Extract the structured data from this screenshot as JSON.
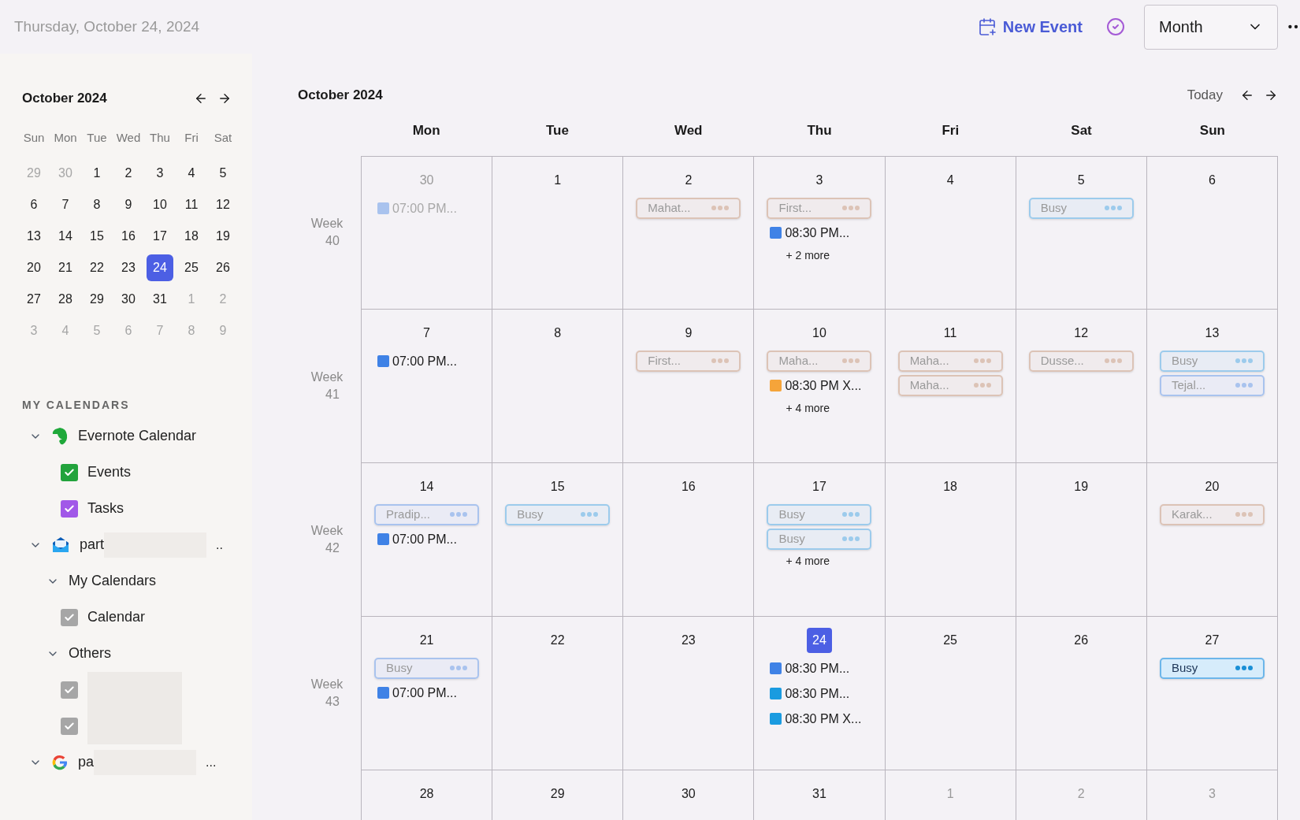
{
  "header": {
    "date": "Thursday, October 24, 2024",
    "new_event": "New Event",
    "view_select": "Month"
  },
  "mini_calendar": {
    "title": "October 2024",
    "weekdays": [
      "Sun",
      "Mon",
      "Tue",
      "Wed",
      "Thu",
      "Fri",
      "Sat"
    ],
    "weeks": [
      [
        {
          "d": "29",
          "outside": true,
          "selected": false
        },
        {
          "d": "30",
          "outside": true,
          "selected": false
        },
        {
          "d": "1",
          "outside": false,
          "selected": false
        },
        {
          "d": "2",
          "outside": false,
          "selected": false
        },
        {
          "d": "3",
          "outside": false,
          "selected": false
        },
        {
          "d": "4",
          "outside": false,
          "selected": false
        },
        {
          "d": "5",
          "outside": false,
          "selected": false
        }
      ],
      [
        {
          "d": "6",
          "outside": false,
          "selected": false
        },
        {
          "d": "7",
          "outside": false,
          "selected": false
        },
        {
          "d": "8",
          "outside": false,
          "selected": false
        },
        {
          "d": "9",
          "outside": false,
          "selected": false
        },
        {
          "d": "10",
          "outside": false,
          "selected": false
        },
        {
          "d": "11",
          "outside": false,
          "selected": false
        },
        {
          "d": "12",
          "outside": false,
          "selected": false
        }
      ],
      [
        {
          "d": "13",
          "outside": false,
          "selected": false
        },
        {
          "d": "14",
          "outside": false,
          "selected": false
        },
        {
          "d": "15",
          "outside": false,
          "selected": false
        },
        {
          "d": "16",
          "outside": false,
          "selected": false
        },
        {
          "d": "17",
          "outside": false,
          "selected": false
        },
        {
          "d": "18",
          "outside": false,
          "selected": false
        },
        {
          "d": "19",
          "outside": false,
          "selected": false
        }
      ],
      [
        {
          "d": "20",
          "outside": false,
          "selected": false
        },
        {
          "d": "21",
          "outside": false,
          "selected": false
        },
        {
          "d": "22",
          "outside": false,
          "selected": false
        },
        {
          "d": "23",
          "outside": false,
          "selected": false
        },
        {
          "d": "24",
          "outside": false,
          "selected": true
        },
        {
          "d": "25",
          "outside": false,
          "selected": false
        },
        {
          "d": "26",
          "outside": false,
          "selected": false
        }
      ],
      [
        {
          "d": "27",
          "outside": false,
          "selected": false
        },
        {
          "d": "28",
          "outside": false,
          "selected": false
        },
        {
          "d": "29",
          "outside": false,
          "selected": false
        },
        {
          "d": "30",
          "outside": false,
          "selected": false
        },
        {
          "d": "31",
          "outside": false,
          "selected": false
        },
        {
          "d": "1",
          "outside": true,
          "selected": false
        },
        {
          "d": "2",
          "outside": true,
          "selected": false
        }
      ],
      [
        {
          "d": "3",
          "outside": true,
          "selected": false
        },
        {
          "d": "4",
          "outside": true,
          "selected": false
        },
        {
          "d": "5",
          "outside": true,
          "selected": false
        },
        {
          "d": "6",
          "outside": true,
          "selected": false
        },
        {
          "d": "7",
          "outside": true,
          "selected": false
        },
        {
          "d": "8",
          "outside": true,
          "selected": false
        },
        {
          "d": "9",
          "outside": true,
          "selected": false
        }
      ]
    ]
  },
  "calendars": {
    "heading": "MY CALENDARS",
    "items": [
      {
        "kind": "account",
        "label": "Evernote Calendar",
        "expanded": true,
        "children": [
          {
            "kind": "check",
            "label": "Events",
            "checked": true,
            "color": "#22a33c"
          },
          {
            "kind": "check",
            "label": "Tasks",
            "checked": true,
            "color": "#a158e8"
          }
        ]
      },
      {
        "kind": "account",
        "label": "part",
        "redacted": true,
        "trail": "..",
        "expanded": true,
        "children": [
          {
            "kind": "group",
            "label": "My Calendars",
            "expanded": true,
            "children": [
              {
                "kind": "check",
                "label": "Calendar",
                "checked": true,
                "color": "#a6a6a6"
              }
            ]
          },
          {
            "kind": "group",
            "label": "Others",
            "expanded": true,
            "children": [
              {
                "kind": "check",
                "redacted": true,
                "checked": true,
                "color": "#a6a6a6"
              },
              {
                "kind": "check",
                "redacted": true,
                "checked": true,
                "color": "#a6a6a6"
              }
            ]
          }
        ]
      },
      {
        "kind": "account",
        "label": "pa",
        "redacted": true,
        "trail": "...",
        "expanded": true
      }
    ]
  },
  "month": {
    "title": "October 2024",
    "today": "Today",
    "weekdays": [
      "Mon",
      "Tue",
      "Wed",
      "Thu",
      "Fri",
      "Sat",
      "Sun"
    ],
    "weeks": [
      {
        "label": "Week",
        "number": "40",
        "days": [
          {
            "date": "30",
            "outside": true,
            "today": false,
            "events": [
              {
                "kind": "timed",
                "title": "07:00 PM...",
                "color": "#a9c3ee"
              }
            ]
          },
          {
            "date": "1",
            "outside": false,
            "today": false
          },
          {
            "date": "2",
            "outside": false,
            "today": false,
            "events": [
              {
                "kind": "pill",
                "title": "Mahat...",
                "color": "#dcc3b6",
                "selected": false
              }
            ]
          },
          {
            "date": "3",
            "outside": false,
            "today": false,
            "events": [
              {
                "kind": "pill",
                "title": "First...",
                "color": "#dcc3b6",
                "selected": false
              },
              {
                "kind": "timed",
                "title": "08:30 PM...",
                "color": "#3f82e6"
              },
              {
                "kind": "more",
                "title": "+ 2 more"
              }
            ]
          },
          {
            "date": "4",
            "outside": false,
            "today": false
          },
          {
            "date": "5",
            "outside": false,
            "today": false,
            "events": [
              {
                "kind": "pill",
                "title": "Busy",
                "color": "#9ccbec",
                "selected": false
              }
            ]
          },
          {
            "date": "6",
            "outside": false,
            "today": false
          }
        ]
      },
      {
        "label": "Week",
        "number": "41",
        "days": [
          {
            "date": "7",
            "outside": false,
            "today": false,
            "events": [
              {
                "kind": "timed",
                "title": "07:00 PM...",
                "color": "#3f82e6"
              }
            ]
          },
          {
            "date": "8",
            "outside": false,
            "today": false
          },
          {
            "date": "9",
            "outside": false,
            "today": false,
            "events": [
              {
                "kind": "pill",
                "title": "First...",
                "color": "#dcc3b6",
                "selected": false
              }
            ]
          },
          {
            "date": "10",
            "outside": false,
            "today": false,
            "events": [
              {
                "kind": "pill",
                "title": "Maha...",
                "color": "#dcc3b6",
                "selected": false
              },
              {
                "kind": "timed",
                "title": "08:30 PM X...",
                "color": "#f5a43a"
              },
              {
                "kind": "more",
                "title": "+ 4 more"
              }
            ]
          },
          {
            "date": "11",
            "outside": false,
            "today": false,
            "events": [
              {
                "kind": "pill",
                "title": "Maha...",
                "color": "#dcc3b6",
                "selected": false
              },
              {
                "kind": "pill",
                "title": "Maha...",
                "color": "#dcc3b6",
                "selected": false
              }
            ]
          },
          {
            "date": "12",
            "outside": false,
            "today": false,
            "events": [
              {
                "kind": "pill",
                "title": "Dusse...",
                "color": "#dcc3b6",
                "selected": false
              }
            ]
          },
          {
            "date": "13",
            "outside": false,
            "today": false,
            "events": [
              {
                "kind": "pill",
                "title": "Busy",
                "color": "#9ccbec",
                "selected": false
              },
              {
                "kind": "pill",
                "title": "Tejal...",
                "color": "#a9c3ee",
                "selected": false
              }
            ]
          }
        ]
      },
      {
        "label": "Week",
        "number": "42",
        "days": [
          {
            "date": "14",
            "outside": false,
            "today": false,
            "events": [
              {
                "kind": "pill",
                "title": "Pradip...",
                "color": "#a9c3ee",
                "selected": false
              },
              {
                "kind": "timed",
                "title": "07:00 PM...",
                "color": "#3f82e6"
              }
            ]
          },
          {
            "date": "15",
            "outside": false,
            "today": false,
            "events": [
              {
                "kind": "pill",
                "title": "Busy",
                "color": "#9ccbec",
                "selected": false
              }
            ]
          },
          {
            "date": "16",
            "outside": false,
            "today": false
          },
          {
            "date": "17",
            "outside": false,
            "today": false,
            "events": [
              {
                "kind": "pill",
                "title": "Busy",
                "color": "#9ccbec",
                "selected": false
              },
              {
                "kind": "pill",
                "title": "Busy",
                "color": "#9ccbec",
                "selected": false
              },
              {
                "kind": "more",
                "title": "+ 4 more"
              }
            ]
          },
          {
            "date": "18",
            "outside": false,
            "today": false
          },
          {
            "date": "19",
            "outside": false,
            "today": false
          },
          {
            "date": "20",
            "outside": false,
            "today": false,
            "events": [
              {
                "kind": "pill",
                "title": "Karak...",
                "color": "#dcc3b6",
                "selected": false
              }
            ]
          }
        ]
      },
      {
        "label": "Week",
        "number": "43",
        "days": [
          {
            "date": "21",
            "outside": false,
            "today": false,
            "events": [
              {
                "kind": "pill",
                "title": "Busy",
                "color": "#a9c3ee",
                "selected": false
              },
              {
                "kind": "timed",
                "title": "07:00 PM...",
                "color": "#3f82e6"
              }
            ]
          },
          {
            "date": "22",
            "outside": false,
            "today": false
          },
          {
            "date": "23",
            "outside": false,
            "today": false
          },
          {
            "date": "24",
            "outside": false,
            "today": true,
            "events": [
              {
                "kind": "timed",
                "title": "08:30 PM...",
                "color": "#3f82e6"
              },
              {
                "kind": "timed",
                "title": "08:30 PM...",
                "color": "#1a9be0"
              },
              {
                "kind": "timed",
                "title": "08:30 PM X...",
                "color": "#1a9be0"
              }
            ]
          },
          {
            "date": "25",
            "outside": false,
            "today": false
          },
          {
            "date": "26",
            "outside": false,
            "today": false
          },
          {
            "date": "27",
            "outside": false,
            "today": false,
            "events": [
              {
                "kind": "pill",
                "title": "Busy",
                "color": "#6cb6ea",
                "selected": true
              }
            ]
          }
        ]
      },
      {
        "days": [
          {
            "date": "28",
            "outside": false,
            "today": false
          },
          {
            "date": "29",
            "outside": false,
            "today": false
          },
          {
            "date": "30",
            "outside": false,
            "today": false
          },
          {
            "date": "31",
            "outside": false,
            "today": false
          },
          {
            "date": "1",
            "outside": true,
            "today": false
          },
          {
            "date": "2",
            "outside": true,
            "today": false
          },
          {
            "date": "3",
            "outside": true,
            "today": false
          }
        ]
      }
    ]
  }
}
